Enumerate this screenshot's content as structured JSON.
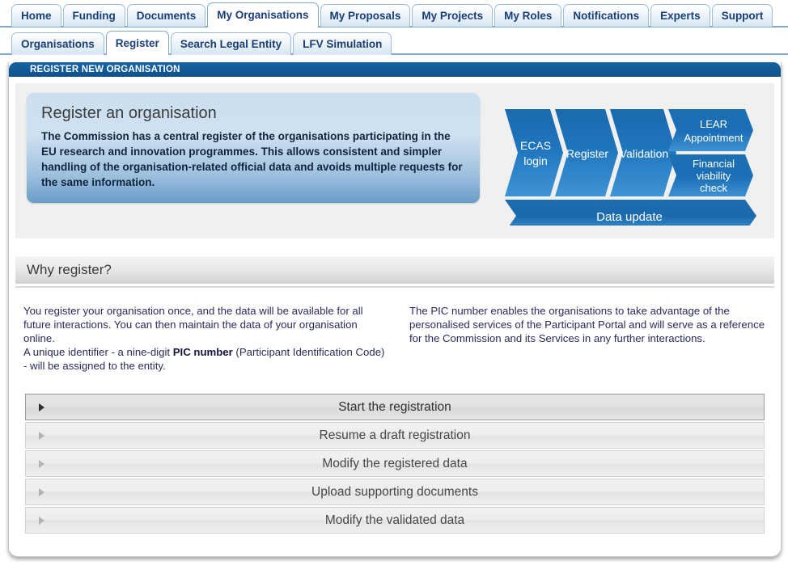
{
  "nav": {
    "primary_tabs": [
      {
        "label": "Home",
        "active": false
      },
      {
        "label": "Funding",
        "active": false
      },
      {
        "label": "Documents",
        "active": false
      },
      {
        "label": "My Organisations",
        "active": true
      },
      {
        "label": "My Proposals",
        "active": false
      },
      {
        "label": "My Projects",
        "active": false
      },
      {
        "label": "My Roles",
        "active": false
      },
      {
        "label": "Notifications",
        "active": false
      },
      {
        "label": "Experts",
        "active": false
      },
      {
        "label": "Support",
        "active": false
      }
    ],
    "secondary_tabs": [
      {
        "label": "Organisations",
        "active": false
      },
      {
        "label": "Register",
        "active": true
      },
      {
        "label": "Search Legal Entity",
        "active": false
      },
      {
        "label": "LFV Simulation",
        "active": false
      }
    ]
  },
  "panel": {
    "header_title": "REGISTER NEW ORGANISATION"
  },
  "hero": {
    "title": "Register an organisation",
    "text": "The Commission has a central register of the organisations participating in the EU research and innovation programmes. This allows consistent and simpler handling of the organisation-related official data and avoids multiple requests for the same information."
  },
  "diagram": {
    "steps": [
      {
        "label_line1": "ECAS",
        "label_line2": "login"
      },
      {
        "label_line1": "Register",
        "label_line2": ""
      },
      {
        "label_line1": "Validation",
        "label_line2": ""
      }
    ],
    "stacked": [
      {
        "label_line1": "LEAR",
        "label_line2": "Appointment",
        "label_line3": ""
      },
      {
        "label_line1": "Financial",
        "label_line2": "viability",
        "label_line3": "check"
      }
    ],
    "footer_step": {
      "label": "Data update"
    }
  },
  "section": {
    "heading": "Why register?"
  },
  "content": {
    "left_paragraph_1": "You register your organisation once, and the data will be available for all future interactions. You can then maintain the data of your organisation online.",
    "left_paragraph_2_before": "A unique identifier - a nine-digit ",
    "left_paragraph_2_bold": "PIC number",
    "left_paragraph_2_after": " (Participant Identification Code) - will be assigned to the entity.",
    "right_paragraph": "The PIC number enables the organisations to take advantage of the personalised services of the Participant Portal and will serve as a reference for the Commission and its Services in any further interactions."
  },
  "accordion": {
    "items": [
      {
        "label": "Start the registration",
        "highlighted": true
      },
      {
        "label": "Resume a draft registration",
        "highlighted": false
      },
      {
        "label": "Modify the registered data",
        "highlighted": false
      },
      {
        "label": "Upload supporting documents",
        "highlighted": false
      },
      {
        "label": "Modify the validated data",
        "highlighted": false
      }
    ]
  },
  "colors": {
    "header_blue": "#0e528c",
    "tab_text_blue": "#1a3e77",
    "chevron_blue": "#1b6cb0",
    "body_text": "#2b2b5a"
  }
}
